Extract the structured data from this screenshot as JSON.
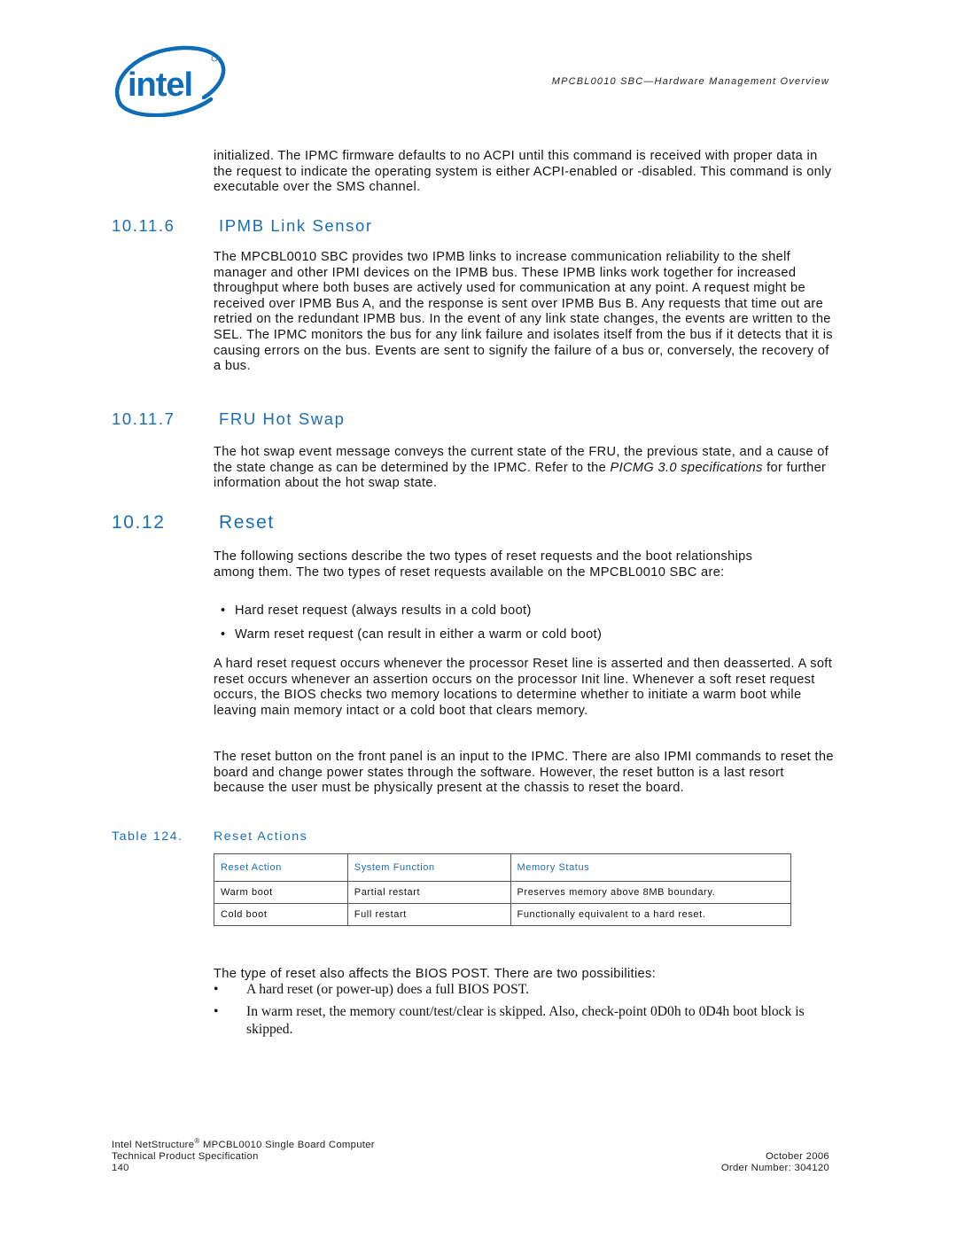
{
  "header": {
    "logo_text": "intel",
    "logo_color": "#0f6cb6",
    "running_title": "MPCBL0010 SBC—Hardware Management Overview"
  },
  "intro_paragraph": "initialized. The IPMC firmware defaults to no ACPI until this command is received with proper data in the request to indicate the operating system is either ACPI-enabled or -disabled. This command is only executable over the SMS channel.",
  "sections": [
    {
      "number": "10.11.6",
      "title": "IPMB Link Sensor",
      "paragraph": "The MPCBL0010 SBC provides two IPMB links to increase communication reliability to the shelf manager and other IPMI devices on the IPMB bus. These IPMB links work together for increased throughput where both buses are actively used for communication at any point. A request might be received over IPMB Bus A, and the response is sent over IPMB Bus B. Any requests that time out are retried on the redundant IPMB bus. In the event of any link state changes, the events are written to the SEL. The IPMC monitors the bus for any link failure and isolates itself from the bus if it detects that it is causing errors on the bus. Events are sent to signify the failure of a bus or, conversely, the recovery of a bus."
    },
    {
      "number": "10.11.7",
      "title": "FRU Hot Swap",
      "paragraph_before": "The hot swap event message conveys the current state of the FRU, the previous state, and a cause of the state change as can be determined by the IPMC. Refer to the ",
      "paragraph_italic": "PICMG 3.0 specifications",
      "paragraph_after": " for further information about the hot swap state."
    }
  ],
  "reset": {
    "number": "10.12",
    "title": "Reset",
    "paragraph1": "The following sections describe the two types of reset requests and the boot relationships among them. The two types of reset requests available on the MPCBL0010 SBC are:",
    "bullets": [
      "Hard reset request (always results in a cold boot)",
      "Warm reset request (can result in either a warm or cold boot)"
    ],
    "paragraph2": "A hard reset request occurs whenever the processor Reset line is asserted and then deasserted. A soft reset occurs whenever an assertion occurs on the processor Init line. Whenever a soft reset request occurs, the BIOS checks two memory locations to determine whether to initiate a warm boot while leaving main memory intact or a cold boot that clears memory.",
    "paragraph3": "The reset button on the front panel is an input to the IPMC. There are also IPMI commands to reset the board and change power states through the software. However, the reset button is a last resort because the user must be physically present at the chassis to reset the board."
  },
  "table": {
    "caption_number": "Table 124.",
    "caption_title": "Reset Actions",
    "headers": [
      "Reset Action",
      "System Function",
      "Memory Status"
    ],
    "rows": [
      [
        "Warm boot",
        "Partial restart",
        "Preserves memory above 8MB boundary."
      ],
      [
        "Cold boot",
        "Full restart",
        "Functionally equivalent to a hard reset."
      ]
    ]
  },
  "post": {
    "paragraph": "The type of reset also affects the BIOS POST. There are two possibilities:",
    "bullets": [
      "A hard reset (or power-up) does a full BIOS POST.",
      "In warm reset, the memory count/test/clear is skipped. Also, check-point 0D0h to 0D4h boot block is skipped."
    ]
  },
  "footer": {
    "product_prefix": "Intel NetStructure",
    "registered": "®",
    "product_suffix": " MPCBL0010 Single Board Computer",
    "doc_type": "Technical Product Specification",
    "page_number": "140",
    "date": "October 2006",
    "order_number": "Order Number: 304120"
  },
  "colors": {
    "heading_blue": "#1a6eb5",
    "table_border": "#555555",
    "text": "#151515"
  }
}
